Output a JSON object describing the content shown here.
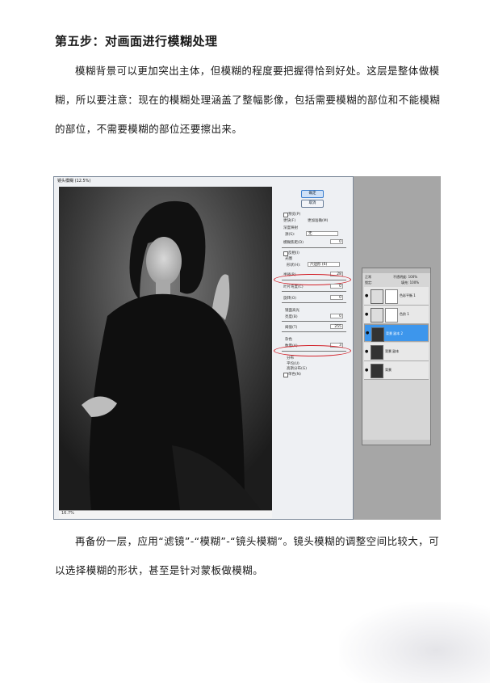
{
  "heading": "第五步：对画面进行模糊处理",
  "paragraph1": "模糊背景可以更加突出主体，但模糊的程度要把握得恰到好处。这层是整体做模糊，所以要注意：现在的模糊处理涵盖了整幅影像，包括需要模糊的部位和不能模糊的部位，不需要模糊的部位还要擦出来。",
  "paragraph2": "再备份一层，应用“滤镜”-“模糊”-“镜头模糊”。镜头模糊的调整空间比较大，可以选择模糊的形状，甚至是针对蒙板做模糊。",
  "screenshot": {
    "dialog_title": "镜头模糊 (12.5%)",
    "ok_label": "确定",
    "cancel_label": "取消",
    "preview_check": "预览(P)",
    "faster": "更快(F)",
    "more_accurate": "更加准确(M)",
    "depth_map": "深度映射",
    "source_label": "源(S):",
    "source_value": "无",
    "blur_focal": "模糊焦距(D)",
    "blur_focal_value": "0",
    "invert": "反相(I)",
    "iris": "光圈",
    "shape_label": "形状(H):",
    "shape_value": "六边形 (6)",
    "radius_label": "半径(R)",
    "radius_value": "28",
    "blade_label": "叶片弯度(C)",
    "blade_value": "0",
    "rotation_label": "旋转(O)",
    "rotation_value": "0",
    "specular": "镜面高光",
    "brightness_label": "亮度(B)",
    "brightness_value": "0",
    "threshold_label": "阈值(T)",
    "threshold_value": "255",
    "noise": "杂色",
    "amount_label": "数量(A)",
    "amount_value": "3",
    "distribution": "分布",
    "uniform": "平均(U)",
    "gaussian": "高斯分布(G)",
    "mono": "单色(N)",
    "zoom": "16.7%"
  },
  "layers_panel": {
    "blend": "正常",
    "opacity": "不透明度: 100%",
    "lock": "锁定:",
    "fill": "填充: 100%",
    "rows": [
      {
        "name": "色彩平衡 1"
      },
      {
        "name": "色阶 1"
      },
      {
        "name": "背景 副本 2"
      },
      {
        "name": "背景 副本"
      },
      {
        "name": "背景"
      }
    ]
  },
  "colors": {
    "accent_selected_layer": "#3d96ec",
    "annotation_red": "#d2222a"
  }
}
